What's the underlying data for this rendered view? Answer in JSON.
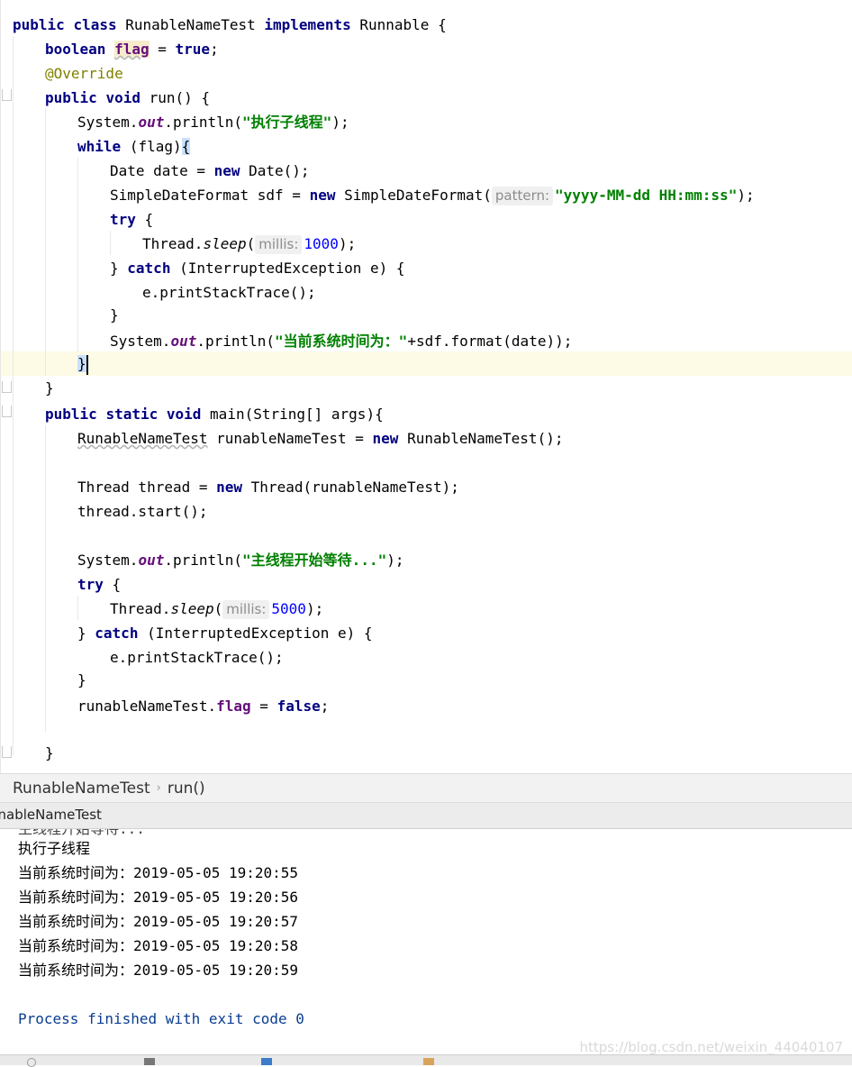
{
  "editor": {
    "lines": {
      "l1": [
        "public",
        "class",
        "RunableNameTest",
        "implements",
        "Runnable",
        "{"
      ],
      "l2": [
        "boolean",
        "flag",
        "=",
        "true",
        ";"
      ],
      "l3": "@Override",
      "l4": [
        "public",
        "void",
        "run()",
        "{"
      ],
      "l5": [
        "System.",
        "out",
        ".println(",
        "\"执行子线程\"",
        ");"
      ],
      "l6": [
        "while",
        "(flag)",
        "{"
      ],
      "l7": [
        "Date date = ",
        "new",
        " Date();"
      ],
      "l8": [
        "SimpleDateFormat sdf = ",
        "new",
        " SimpleDateFormat(",
        "pattern:",
        "\"yyyy-MM-dd HH:mm:ss\"",
        ");"
      ],
      "l9": [
        "try",
        "{"
      ],
      "l10": [
        "Thread.",
        "sleep",
        "(",
        "millis:",
        "1000",
        ");"
      ],
      "l11": [
        "}",
        "catch",
        "(InterruptedException e) {"
      ],
      "l12": "e.printStackTrace();",
      "l13": "}",
      "l14": [
        "System.",
        "out",
        ".println(",
        "\"当前系统时间为：\"",
        "+sdf.format(date));"
      ],
      "l15": "}",
      "l16": "}",
      "l17": [
        "public",
        "static",
        "void",
        "main(String[] args){"
      ],
      "l18": [
        "RunableNameTest",
        " runableNameTest = ",
        "new",
        " RunableNameTest();"
      ],
      "l20": [
        "Thread thread = ",
        "new",
        " Thread(runableNameTest);"
      ],
      "l21": "thread.start();",
      "l23": [
        "System.",
        "out",
        ".println(",
        "\"主线程开始等待...\"",
        ");"
      ],
      "l24": [
        "try",
        "{"
      ],
      "l25": [
        "Thread.",
        "sleep",
        "(",
        "millis:",
        "5000",
        ");"
      ],
      "l26": [
        "}",
        "catch",
        "(InterruptedException e) {"
      ],
      "l27": "e.printStackTrace();",
      "l28": "}",
      "l29": [
        "runableNameTest.",
        "flag",
        " = ",
        "false",
        ";"
      ],
      "l31": "}"
    }
  },
  "breadcrumb": {
    "class_name": "RunableNameTest",
    "separator": "›",
    "method": "run()"
  },
  "run_tab": {
    "label": "unableNameTest"
  },
  "console": {
    "clipped_top": "主线程开始等待...",
    "lines": [
      "执行子线程",
      "当前系统时间为：2019-05-05 19:20:55",
      "当前系统时间为：2019-05-05 19:20:56",
      "当前系统时间为：2019-05-05 19:20:57",
      "当前系统时间为：2019-05-05 19:20:58",
      "当前系统时间为：2019-05-05 19:20:59"
    ],
    "exit_message": "Process finished with exit code 0"
  },
  "watermark": "https://blog.csdn.net/weixin_44040107",
  "colors": {
    "keyword": "#000080",
    "field": "#660e7a",
    "string": "#008000",
    "number": "#0000ff",
    "annotation": "#808000",
    "caret_row": "#fdfbe6"
  }
}
